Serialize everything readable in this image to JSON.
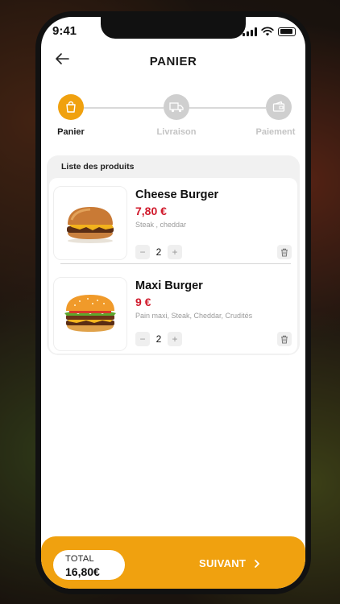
{
  "status_bar": {
    "time": "9:41"
  },
  "header": {
    "title": "PANIER"
  },
  "stepper": {
    "steps": [
      {
        "label": "Panier",
        "state": "active",
        "icon": "shopping-bag-icon"
      },
      {
        "label": "Livraison",
        "state": "inactive",
        "icon": "delivery-truck-icon"
      },
      {
        "label": "Paiement",
        "state": "inactive",
        "icon": "wallet-card-icon"
      }
    ]
  },
  "cart": {
    "title": "Liste des produits",
    "items": [
      {
        "name": "Cheese Burger",
        "price": "7,80 €",
        "description": "Steak , cheddar",
        "quantity": "2",
        "minus": "−",
        "plus": "+"
      },
      {
        "name": "Maxi Burger",
        "price": "9 €",
        "description": "Pain maxi, Steak, Cheddar, Crudités",
        "quantity": "2",
        "minus": "−",
        "plus": "+"
      }
    ]
  },
  "footer": {
    "total_label": "TOTAL",
    "total_value": "16,80€",
    "next_label": "SUIVANT"
  },
  "colors": {
    "accent": "#f0a10f",
    "price": "#d0192b"
  }
}
